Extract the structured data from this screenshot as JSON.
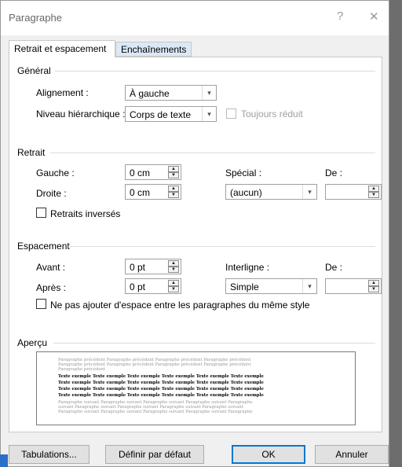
{
  "dialog": {
    "title": "Paragraphe",
    "help_glyph": "?",
    "close_glyph": "✕"
  },
  "tabs": [
    {
      "label": "Retrait et espacement"
    },
    {
      "label": "Enchaînements"
    }
  ],
  "general": {
    "section": "Général",
    "alignment_label": "Alignement :",
    "alignment_value": "À gauche",
    "level_label": "Niveau hiérarchique :",
    "level_value": "Corps de texte",
    "collapsed_label": "Toujours réduit"
  },
  "indent": {
    "section": "Retrait",
    "left_label": "Gauche :",
    "left_value": "0 cm",
    "right_label": "Droite :",
    "right_value": "0 cm",
    "special_label": "Spécial :",
    "special_value": "(aucun)",
    "by_label": "De :",
    "by_value": "",
    "mirror_label": "Retraits inversés"
  },
  "spacing": {
    "section": "Espacement",
    "before_label": "Avant :",
    "before_value": "0 pt",
    "after_label": "Après :",
    "after_value": "0 pt",
    "line_label": "Interligne :",
    "line_value": "Simple",
    "at_label": "De :",
    "at_value": "",
    "no_space_label": "Ne pas ajouter d'espace entre les paragraphes du même style"
  },
  "preview": {
    "section": "Aperçu",
    "prev_lines": [
      "Paragraphe précédent Paragraphe précédent Paragraphe précédent Paragraphe précédent",
      "Paragraphe précédent Paragraphe précédent Paragraphe précédent Paragraphe précédent",
      "Paragraphe précédent"
    ],
    "sample_lines": [
      "Texte exemple Texte exemple Texte exemple Texte exemple Texte exemple Texte exemple",
      "Texte exemple Texte exemple Texte exemple Texte exemple Texte exemple Texte exemple",
      "Texte exemple Texte exemple Texte exemple Texte exemple Texte exemple Texte exemple",
      "Texte exemple Texte exemple Texte exemple Texte exemple Texte exemple Texte exemple"
    ],
    "next_lines": [
      "Paragraphe suivant Paragraphe suivant Paragraphe suivant Paragraphe suivant Paragraphe",
      "suivant Paragraphe suivant Paragraphe suivant Paragraphe suivant Paragraphe suivant",
      "Paragraphe suivant Paragraphe suivant Paragraphe suivant Paragraphe suivant Paragraphe"
    ]
  },
  "buttons": {
    "tabs": "Tabulations...",
    "default": "Définir par défaut",
    "ok": "OK",
    "cancel": "Annuler"
  }
}
